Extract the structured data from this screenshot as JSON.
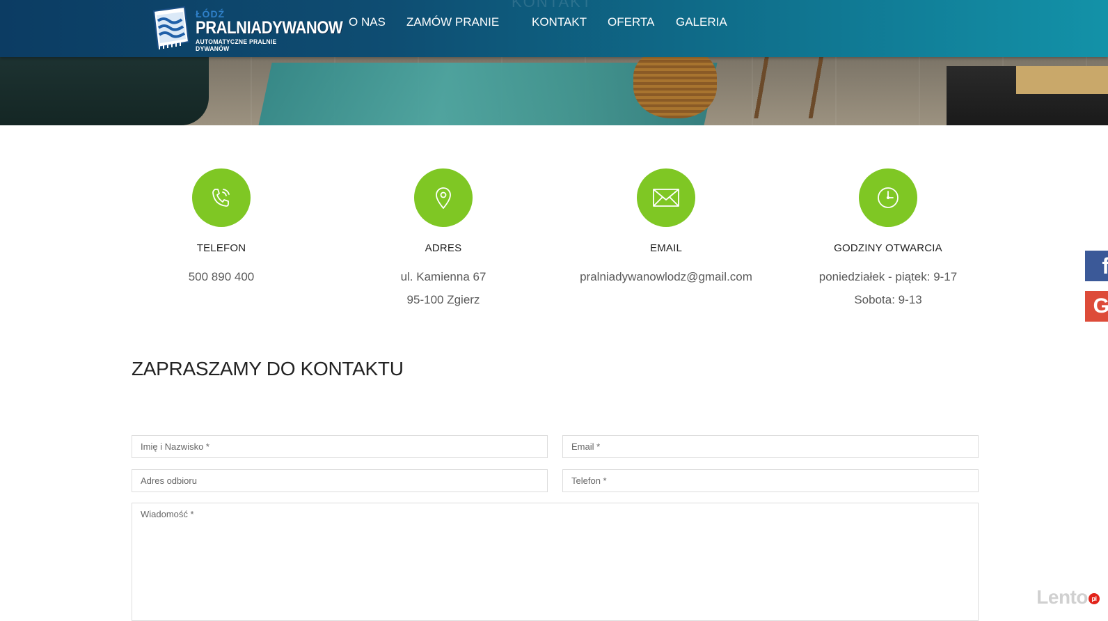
{
  "header": {
    "ghost_title": "KONTAKT",
    "logo": {
      "city": "ŁÓDŹ",
      "brand": "PRALNIADYWANOW",
      "tagline": "AUTOMATYCZNE PRALNIE DYWANÓW"
    },
    "nav": [
      {
        "label": "O NAS"
      },
      {
        "label": "ZAMÓW PRANIE"
      },
      {
        "label": "KONTAKT"
      },
      {
        "label": "OFERTA"
      },
      {
        "label": "GALERIA"
      }
    ]
  },
  "info": [
    {
      "icon": "phone-icon",
      "label": "TELEFON",
      "lines": [
        "500 890 400"
      ]
    },
    {
      "icon": "location-pin-icon",
      "label": "ADRES",
      "lines": [
        "ul. Kamienna 67",
        "95-100 Zgierz"
      ]
    },
    {
      "icon": "envelope-icon",
      "label": "EMAIL",
      "lines": [
        "pralniadywanowlodz@gmail.com"
      ]
    },
    {
      "icon": "clock-icon",
      "label": "GODZINY OTWARCIA",
      "lines": [
        "poniedziałek - piątek: 9-17",
        "Sobota: 9-13"
      ]
    }
  ],
  "contact": {
    "title": "ZAPRASZAMY DO KONTAKTU",
    "fields": {
      "name": {
        "value": "",
        "placeholder": "Imię i Nazwisko *"
      },
      "email": {
        "value": "",
        "placeholder": "Email *"
      },
      "address": {
        "value": "",
        "placeholder": "Adres odbioru"
      },
      "phone": {
        "value": "",
        "placeholder": "Telefon *"
      },
      "message": {
        "value": "",
        "placeholder": "Wiadomość *"
      }
    }
  },
  "social": {
    "facebook": {
      "glyph": "f",
      "icon": "facebook-icon"
    },
    "google": {
      "glyph": "G",
      "icon": "google-plus-icon"
    }
  },
  "watermark": {
    "text": "Lento",
    "suffix": "pl"
  },
  "colors": {
    "accent_green": "#7fc724",
    "nav_dark": "#0c3c63",
    "nav_light": "#1392a8",
    "facebook": "#3b5998",
    "google": "#dd4b39"
  }
}
